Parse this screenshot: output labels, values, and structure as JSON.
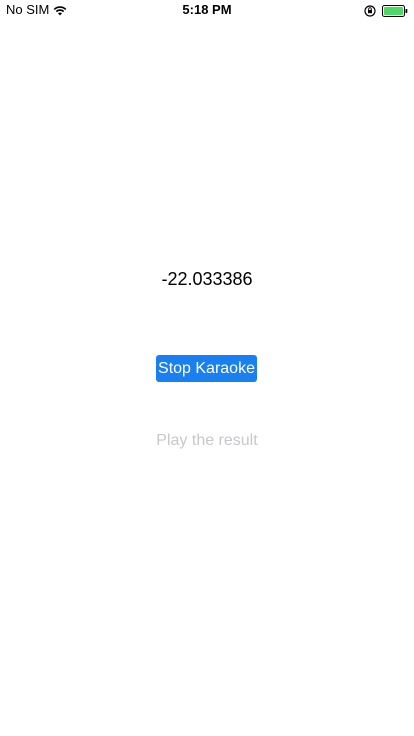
{
  "status_bar": {
    "carrier": "No SIM",
    "time": "5:18 PM",
    "icons": {
      "wifi": "wifi-icon",
      "rotation_lock": "rotation-lock-icon",
      "battery": "battery-icon"
    },
    "battery_color": "#4cd964"
  },
  "main": {
    "value": "-22.033386",
    "stop_button_label": "Stop Karaoke",
    "play_button_label": "Play the result",
    "accent_color": "#1a7ff0",
    "disabled_text_color": "#c7c7cc"
  }
}
